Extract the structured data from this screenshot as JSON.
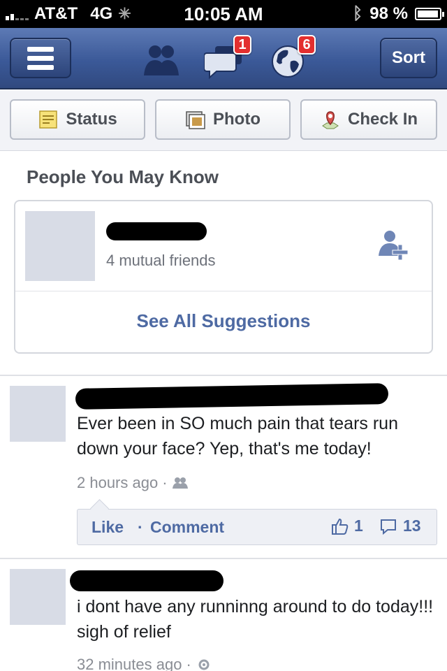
{
  "status_bar": {
    "carrier": "AT&T",
    "network": "4G",
    "time": "10:05 AM",
    "battery_text": "98 %",
    "battery_level": 0.98
  },
  "nav": {
    "sort_label": "Sort",
    "messages_badge": "1",
    "notifications_badge": "6",
    "icons": [
      "menu-icon",
      "friend-requests-icon",
      "messages-icon",
      "notifications-globe-icon"
    ]
  },
  "publisher": {
    "status_label": "Status",
    "photo_label": "Photo",
    "checkin_label": "Check In"
  },
  "pymk": {
    "title": "People You May Know",
    "mutual_friends": "4 mutual friends",
    "see_all": "See All Suggestions"
  },
  "posts": [
    {
      "text": "Ever been in SO much pain that tears run down your face? Yep, that's me today!",
      "time": "2 hours ago",
      "dot": "·",
      "like_label": "Like",
      "sep": "·",
      "comment_label": "Comment",
      "like_count": "1",
      "comment_count": "13"
    },
    {
      "text": "i dont have any runninng around to do today!!! sigh of relief",
      "time": "32 minutes ago",
      "dot": "·"
    }
  ],
  "colors": {
    "nav_blue": "#3b5998",
    "link_blue": "#4e6aa3",
    "badge_red": "#e32f2f"
  }
}
